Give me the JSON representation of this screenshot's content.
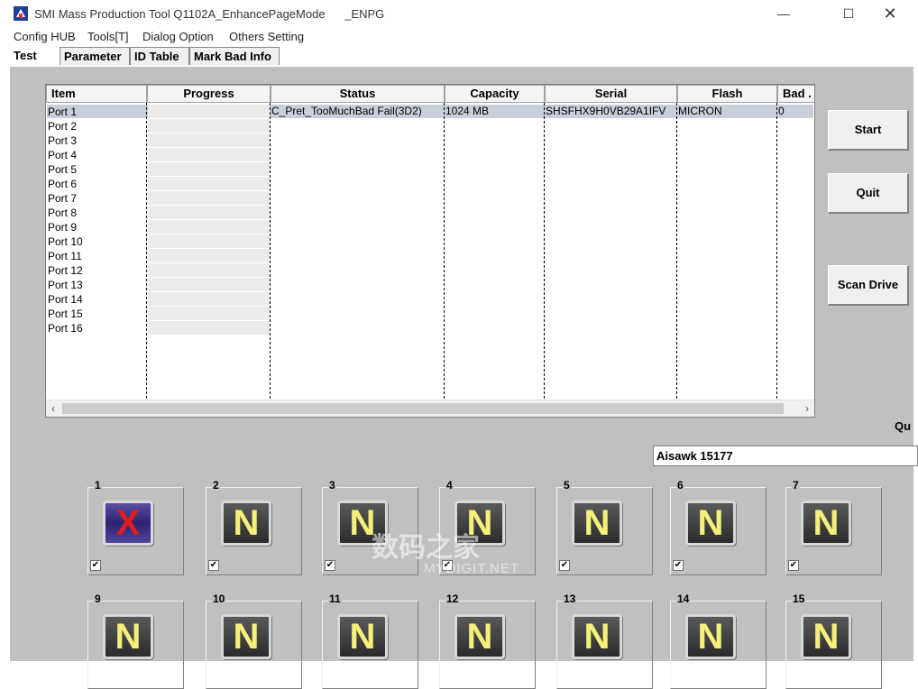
{
  "window": {
    "title": "SMI Mass Production Tool Q1102A_EnhancePageMode      _ENPG",
    "min_glyph": "—",
    "max_glyph": "☐",
    "close_glyph": "✕"
  },
  "menu": [
    "Config HUB",
    "Tools[T]",
    "Dialog Option",
    "Others Setting"
  ],
  "tabs": [
    "Test",
    "Parameter",
    "ID Table",
    "Mark Bad Info"
  ],
  "table": {
    "columns": [
      "Item",
      "Progress",
      "Status",
      "Capacity",
      "Serial",
      "Flash",
      "Bad ."
    ],
    "rows": [
      "Port 1",
      "Port 2",
      "Port 3",
      "Port 4",
      "Port 5",
      "Port 6",
      "Port 7",
      "Port 8",
      "Port 9",
      "Port 10",
      "Port 11",
      "Port 12",
      "Port 13",
      "Port 14",
      "Port 15",
      "Port 16"
    ],
    "port1": {
      "status": "C_Pret_TooMuchBad Fail(3D2)",
      "capacity": "1024 MB",
      "serial": "SHSFHX9H0VB29A1IFV",
      "flash": "MICRON",
      "bad": "0"
    }
  },
  "buttons": {
    "start": "Start",
    "quit": "Quit",
    "scan_drive": "Scan Drive"
  },
  "qu_label": "Qu",
  "aisawk_field": "Aisawk 15177",
  "slots": [
    {
      "num": "1",
      "letter": "X",
      "state": "fail",
      "checked": true
    },
    {
      "num": "2",
      "letter": "N",
      "state": "idle",
      "checked": true
    },
    {
      "num": "3",
      "letter": "N",
      "state": "idle",
      "checked": true
    },
    {
      "num": "4",
      "letter": "N",
      "state": "idle",
      "checked": true
    },
    {
      "num": "5",
      "letter": "N",
      "state": "idle",
      "checked": true
    },
    {
      "num": "6",
      "letter": "N",
      "state": "idle",
      "checked": true
    },
    {
      "num": "7",
      "letter": "N",
      "state": "idle",
      "checked": true
    },
    {
      "num": "9",
      "letter": "N",
      "state": "idle",
      "checked": false
    },
    {
      "num": "10",
      "letter": "N",
      "state": "idle",
      "checked": false
    },
    {
      "num": "11",
      "letter": "N",
      "state": "idle",
      "checked": false
    },
    {
      "num": "12",
      "letter": "N",
      "state": "idle",
      "checked": false
    },
    {
      "num": "13",
      "letter": "N",
      "state": "idle",
      "checked": false
    },
    {
      "num": "14",
      "letter": "N",
      "state": "idle",
      "checked": false
    },
    {
      "num": "15",
      "letter": "N",
      "state": "idle",
      "checked": false
    }
  ],
  "watermark": {
    "main": "数码之家",
    "sub": "MYDIGIT.NET"
  },
  "colors": {
    "panel": "#c0c0c0",
    "selected_row": "#c8cfd9",
    "n_letter": "#f5f07a",
    "x_letter": "#e31b1b"
  }
}
